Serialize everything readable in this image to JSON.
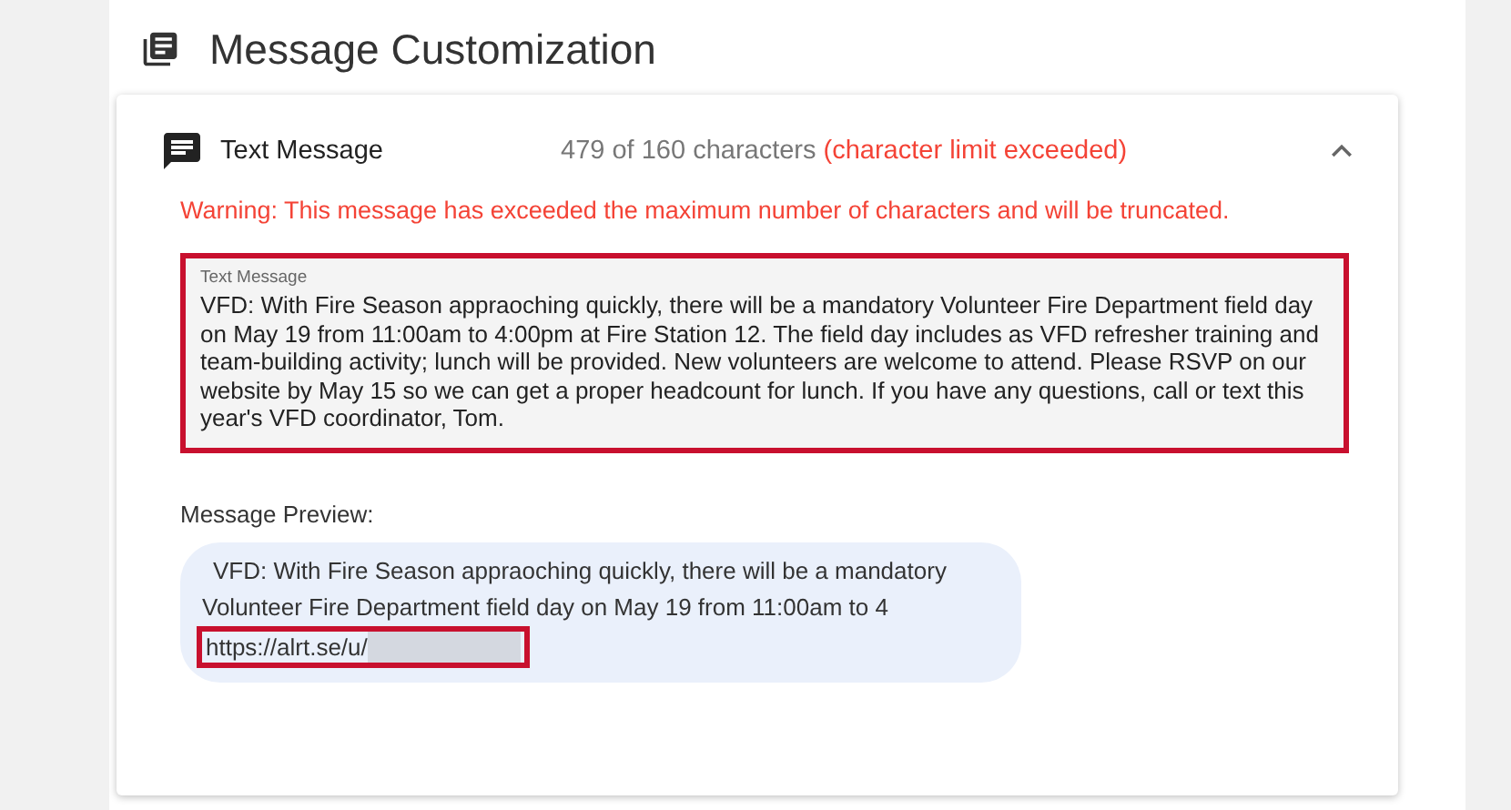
{
  "section": {
    "title": "Message Customization"
  },
  "panel": {
    "title": "Text Message",
    "expanded": true,
    "count": "479 of 160 characters",
    "count_error": "(character limit exceeded)",
    "warning": "Warning: This message has exceeded the maximum number of characters and will be truncated.",
    "field": {
      "label": "Text Message",
      "value": "VFD: With Fire Season appraoching quickly, there will be a mandatory Volunteer Fire Department field day on May 19 from 11:00am to 4:00pm at Fire Station 12. The field day includes as VFD refresher training and team-building activity; lunch will be provided. New volunteers are welcome to attend. Please RSVP on our website by May 15 so we can get a proper headcount for lunch. If you have any questions, call or text this year's VFD coordinator, Tom."
    },
    "preview_label": "Message Preview:",
    "preview_lines": [
      "VFD: With Fire Season appraoching quickly, there will be a mandatory",
      "Volunteer Fire Department field day on May 19 from 11:00am to 4"
    ],
    "preview_link": "https://alrt.se/u/"
  }
}
